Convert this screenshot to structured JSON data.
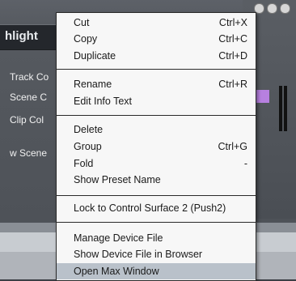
{
  "background": {
    "title": "hlight",
    "rows": [
      "Track Co",
      "Scene C",
      "Clip Col",
      "w Scene"
    ],
    "swatch_color": "#b780e0"
  },
  "menu": {
    "items": [
      {
        "label": "Cut",
        "shortcut": "Ctrl+X"
      },
      {
        "label": "Copy",
        "shortcut": "Ctrl+C"
      },
      {
        "label": "Duplicate",
        "shortcut": "Ctrl+D"
      },
      {
        "label": "Rename",
        "shortcut": "Ctrl+R"
      },
      {
        "label": "Edit Info Text",
        "shortcut": ""
      },
      {
        "label": "Delete",
        "shortcut": ""
      },
      {
        "label": "Group",
        "shortcut": "Ctrl+G"
      },
      {
        "label": "Fold",
        "shortcut": "-"
      },
      {
        "label": "Show Preset Name",
        "shortcut": ""
      },
      {
        "label": "Lock to Control Surface 2 (Push2)",
        "shortcut": ""
      },
      {
        "label": "Manage Device File",
        "shortcut": ""
      },
      {
        "label": "Show Device File in Browser",
        "shortcut": ""
      },
      {
        "label": "Open Max Window",
        "shortcut": ""
      }
    ],
    "highlighted": "Open Max Window"
  }
}
